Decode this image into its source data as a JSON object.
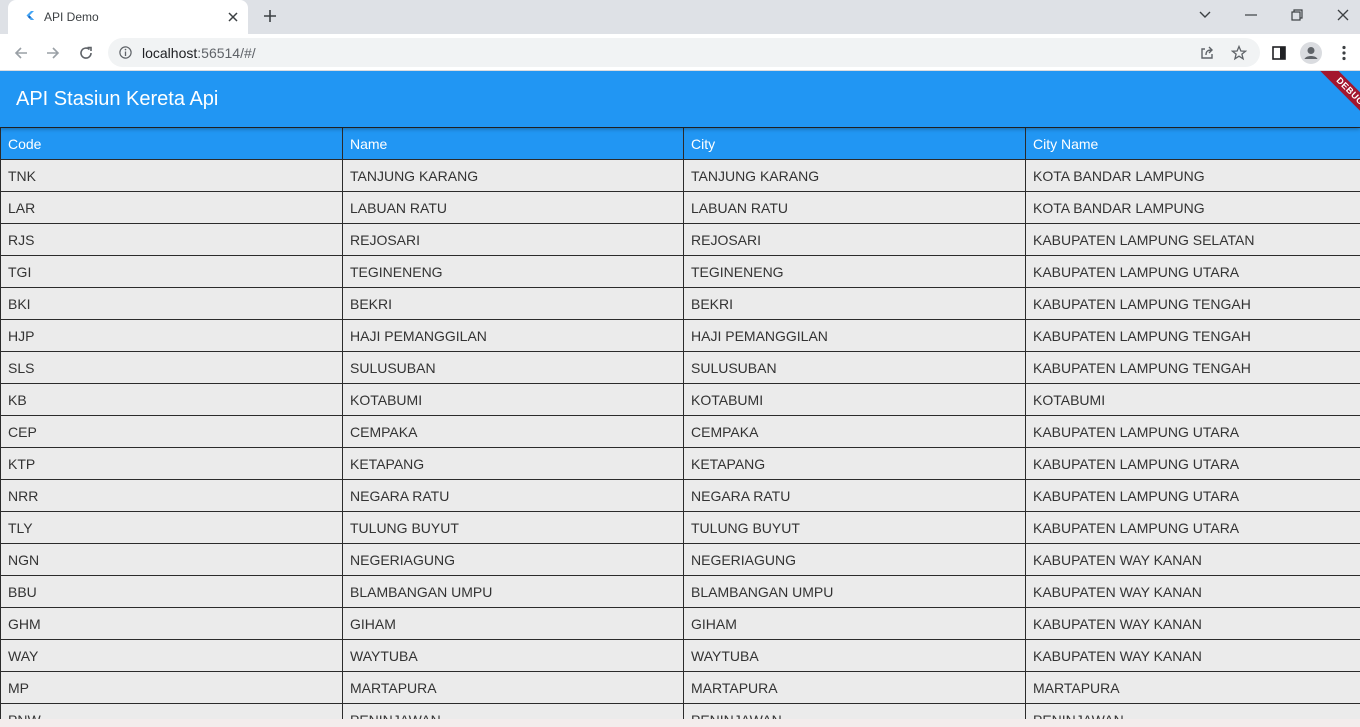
{
  "browser": {
    "tab_title": "API Demo",
    "url_host": "localhost",
    "url_rest": ":56514/#/"
  },
  "app": {
    "title": "API Stasiun Kereta Api",
    "debug_label": "DEBUG",
    "colors": {
      "primary": "#2196f3",
      "debug_ribbon": "#a3162e",
      "row_bg": "#ebebeb"
    }
  },
  "table": {
    "headers": [
      "Code",
      "Name",
      "City",
      "City Name"
    ],
    "rows": [
      [
        "TNK",
        "TANJUNG KARANG",
        "TANJUNG KARANG",
        "KOTA BANDAR LAMPUNG"
      ],
      [
        "LAR",
        "LABUAN RATU",
        "LABUAN RATU",
        "KOTA BANDAR LAMPUNG"
      ],
      [
        "RJS",
        "REJOSARI",
        "REJOSARI",
        "KABUPATEN LAMPUNG SELATAN"
      ],
      [
        "TGI",
        "TEGINENENG",
        "TEGINENENG",
        "KABUPATEN LAMPUNG UTARA"
      ],
      [
        "BKI",
        "BEKRI",
        "BEKRI",
        "KABUPATEN LAMPUNG TENGAH"
      ],
      [
        "HJP",
        "HAJI PEMANGGILAN",
        "HAJI PEMANGGILAN",
        "KABUPATEN LAMPUNG TENGAH"
      ],
      [
        "SLS",
        "SULUSUBAN",
        "SULUSUBAN",
        "KABUPATEN LAMPUNG TENGAH"
      ],
      [
        "KB",
        "KOTABUMI",
        "KOTABUMI",
        "KOTABUMI"
      ],
      [
        "CEP",
        "CEMPAKA",
        "CEMPAKA",
        "KABUPATEN LAMPUNG UTARA"
      ],
      [
        "KTP",
        "KETAPANG",
        "KETAPANG",
        "KABUPATEN LAMPUNG UTARA"
      ],
      [
        "NRR",
        "NEGARA RATU",
        "NEGARA RATU",
        "KABUPATEN LAMPUNG UTARA"
      ],
      [
        "TLY",
        "TULUNG BUYUT",
        "TULUNG BUYUT",
        "KABUPATEN LAMPUNG UTARA"
      ],
      [
        "NGN",
        "NEGERIAGUNG",
        "NEGERIAGUNG",
        "KABUPATEN WAY KANAN"
      ],
      [
        "BBU",
        "BLAMBANGAN UMPU",
        "BLAMBANGAN UMPU",
        "KABUPATEN WAY KANAN"
      ],
      [
        "GHM",
        "GIHAM",
        "GIHAM",
        "KABUPATEN WAY KANAN"
      ],
      [
        "WAY",
        "WAYTUBA",
        "WAYTUBA",
        "KABUPATEN WAY KANAN"
      ],
      [
        "MP",
        "MARTAPURA",
        "MARTAPURA",
        "MARTAPURA"
      ],
      [
        "PNW",
        "PENINJAWAN",
        "PENINJAWAN",
        "PENINJAWAN"
      ]
    ]
  }
}
